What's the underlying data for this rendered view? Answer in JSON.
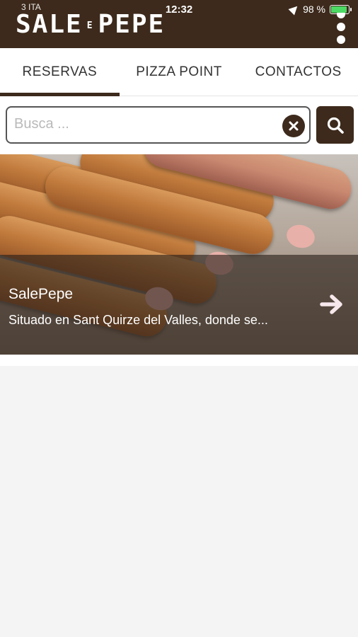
{
  "status_bar": {
    "carrier": "3 ITA",
    "time": "12:32",
    "battery": "98 %",
    "battery_level": 0.98
  },
  "header": {
    "logo_left": "SALE",
    "logo_mid": "E",
    "logo_right": "PEPE"
  },
  "tabs": [
    {
      "label": "RESERVAS",
      "active": true
    },
    {
      "label": "PIZZA POINT",
      "active": false
    },
    {
      "label": "CONTACTOS",
      "active": false
    }
  ],
  "search": {
    "placeholder": "Busca ...",
    "value": ""
  },
  "card": {
    "title": "SalePepe",
    "description": "Situado en Sant Quirze del Valles, donde se..."
  },
  "colors": {
    "brand": "#3d2a1c",
    "background": "#f4f4f4"
  },
  "icons": {
    "menu": "more-vertical-icon",
    "clear": "close-circle-icon",
    "search": "search-icon",
    "arrow": "arrow-right-icon"
  }
}
